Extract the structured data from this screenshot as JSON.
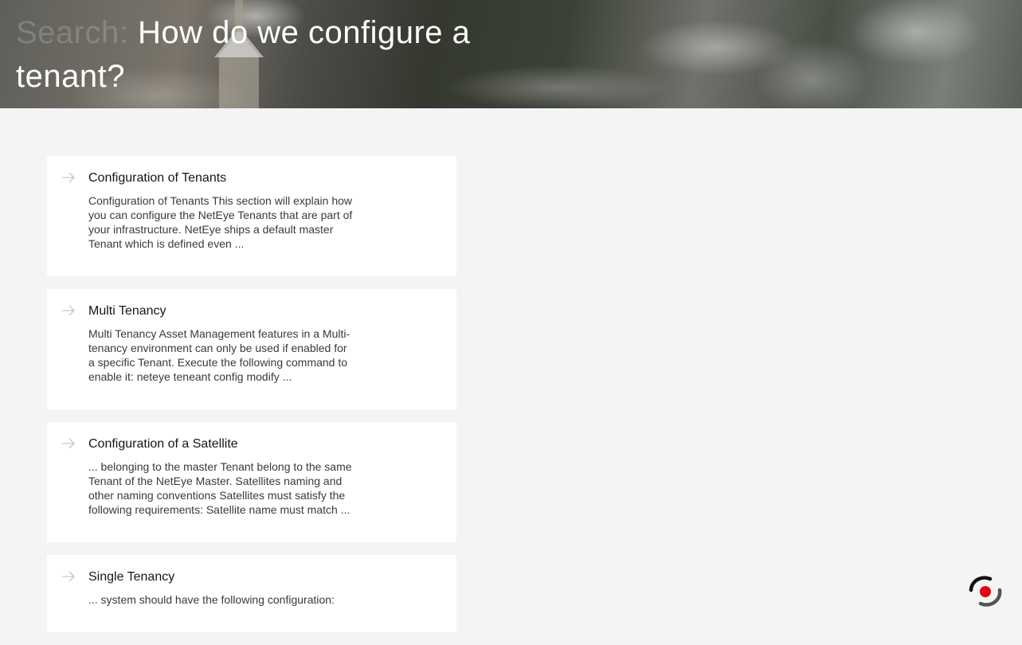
{
  "hero": {
    "title_prefix": "Search:",
    "title": " How do we configure a tenant?"
  },
  "results": [
    {
      "title": "Configuration of Tenants",
      "snippet": "Configuration of Tenants This section will explain how you can configure the NetEye Tenants that are part of your infrastructure. NetEye ships a default master Tenant which is defined even ..."
    },
    {
      "title": "Multi Tenancy",
      "snippet": "Multi Tenancy Asset Management features in a Multi-tenancy environment can only be used if enabled for a specific Tenant. Execute the following command to enable it: neteye teneant config modify ..."
    },
    {
      "title": "Configuration of a Satellite",
      "snippet": "... belonging to the master Tenant belong to the same Tenant of the NetEye Master. Satellites naming and other naming conventions Satellites must satisfy the following requirements: Satellite name must match ..."
    },
    {
      "title": "Single Tenancy",
      "snippet": "... system should have the following configuration:"
    }
  ],
  "icons": {
    "result_arrow": "arrow-right-icon",
    "assistant": "assistant-logo-icon"
  },
  "colors": {
    "page_bg": "#f4f4f4",
    "card_bg": "#ffffff",
    "accent_red": "#e60012",
    "arrow": "#c6c6c6"
  }
}
